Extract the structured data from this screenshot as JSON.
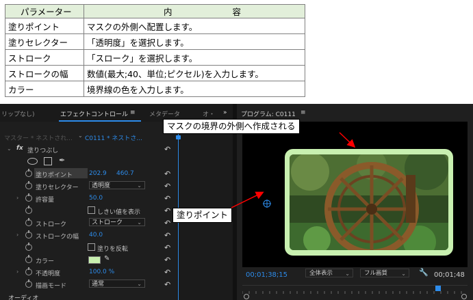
{
  "table": {
    "headers": [
      "パラメーター",
      "内",
      "容"
    ],
    "rows": [
      {
        "param": "塗りポイント",
        "desc": "マスクの外側へ配置します。"
      },
      {
        "param": "塗りセレクター",
        "desc": "「透明度」を選択します。"
      },
      {
        "param": "ストローク",
        "desc": "「スローク」を選択します。"
      },
      {
        "param": "ストロークの幅",
        "desc": "数値(最大;40、単位;ピクセル)を入力します。"
      },
      {
        "param": "カラー",
        "desc": "境界線の色を入力します。"
      }
    ]
  },
  "effect_panel": {
    "tabs": [
      "リップなし)",
      "エフェクトコントロール",
      "≡",
      "メタデータ",
      "オ・",
      "»"
    ],
    "master": "マスター * ネストされ...",
    "clip": "C0111 * ネストさ...",
    "timeline_marks": [
      "02",
      "0"
    ],
    "effect_name": "塗りつぶし",
    "params": [
      {
        "label": "塗りポイント",
        "v1": "202.9",
        "v2": "460.7"
      },
      {
        "label": "塗りセレクター",
        "dropdown": "透明度"
      },
      {
        "label": "許容量",
        "v1": "50.0"
      },
      {
        "checkbox": "しきい値を表示"
      },
      {
        "label": "ストローク",
        "dropdown": "ストローク"
      },
      {
        "label": "ストロークの幅",
        "v1": "40.0"
      },
      {
        "checkbox": "塗りを反転"
      },
      {
        "label": "カラー"
      },
      {
        "label": "不透明度",
        "v1": "100.0 %"
      },
      {
        "label": "描画モード",
        "dropdown": "通常"
      }
    ],
    "audio_label": "オーディオ"
  },
  "program_panel": {
    "title": "プログラム: C0111",
    "menu": "≡",
    "timecode": "00;01;38;15",
    "zoom": "全体表示",
    "quality": "フル画質",
    "end_timecode": "00;01;48"
  },
  "callouts": {
    "mask_outside": "マスクの境界の外側へ作成される",
    "fill_point": "塗りポイント"
  },
  "colors": {
    "accent_blue": "#2d8ceb",
    "stroke_color": "#c8f0b0",
    "table_header_bg": "#e2efda"
  }
}
